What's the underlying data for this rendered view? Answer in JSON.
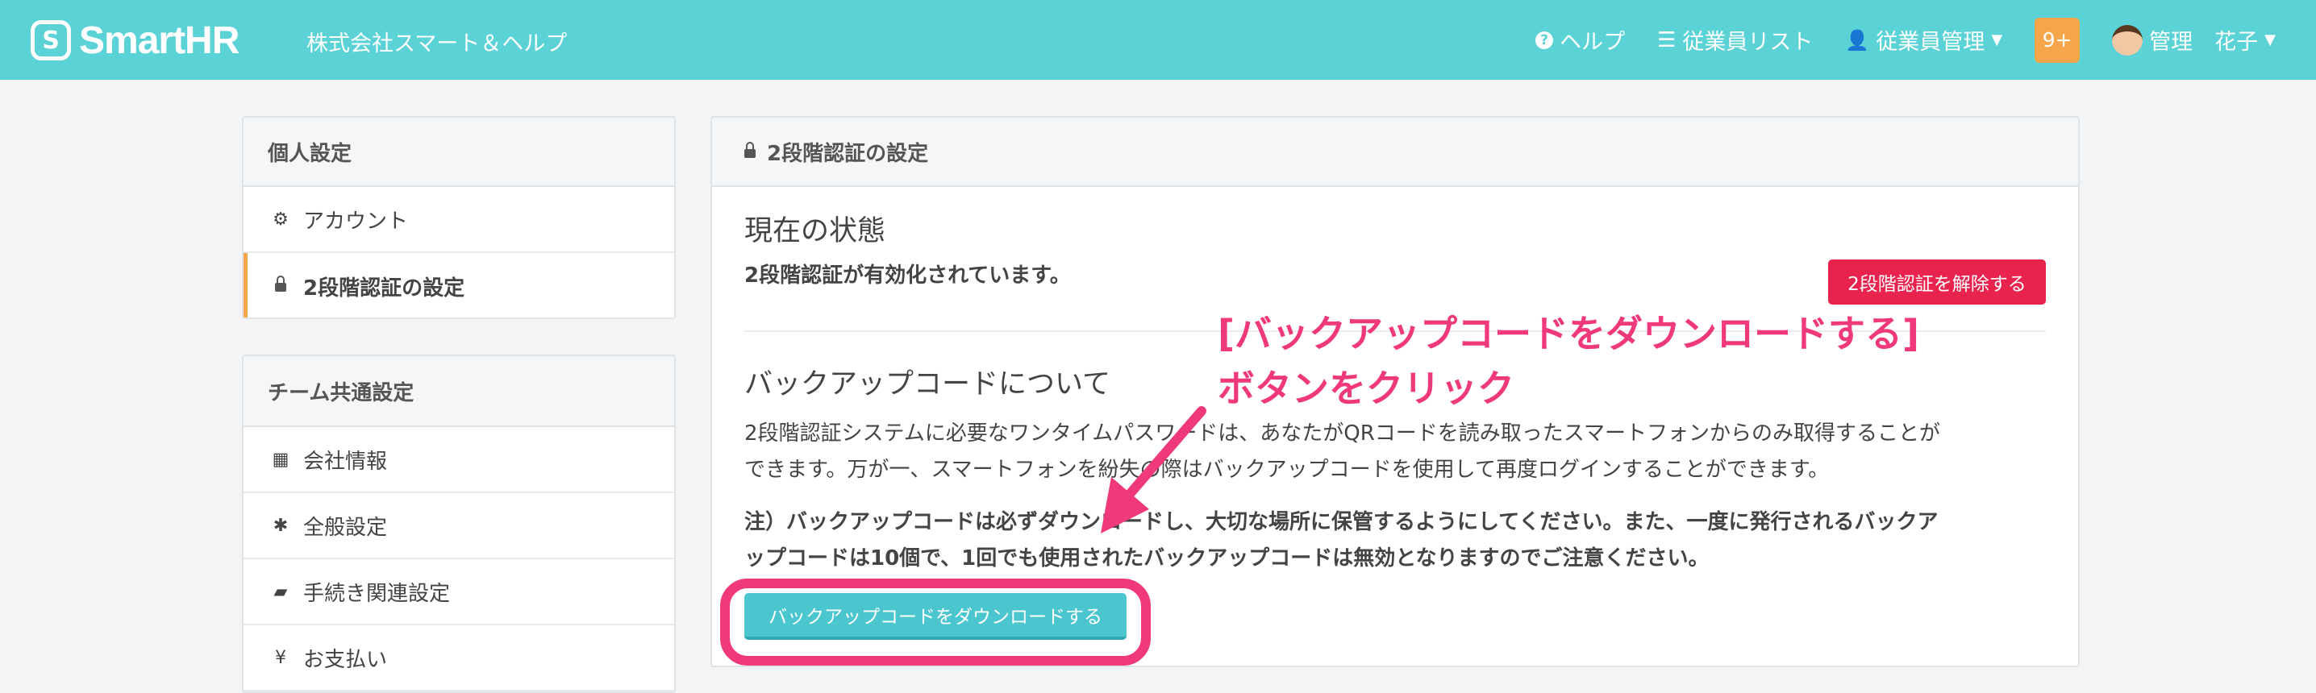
{
  "header": {
    "brand": "SmartHR",
    "logo_mark": "S",
    "company": "株式会社スマート＆ヘルプ",
    "help": "ヘルプ",
    "employee_list": "従業員リスト",
    "employee_manage": "従業員管理",
    "notification_badge": "9+",
    "user": "管理　花子",
    "icons": [
      "question-circle-icon",
      "list-icon",
      "user-icon",
      "chevron-down-icon"
    ],
    "colors": {
      "bar": "#5ad2d6",
      "badge": "#f5a64a"
    }
  },
  "sidebar": {
    "personal": {
      "title": "個人設定",
      "items": [
        {
          "label": "アカウント",
          "icon": "gear-icon"
        },
        {
          "label": "2段階認証の設定",
          "icon": "lock-icon",
          "active": true
        }
      ]
    },
    "team": {
      "title": "チーム共通設定",
      "items": [
        {
          "label": "会社情報",
          "icon": "building-icon"
        },
        {
          "label": "全般設定",
          "icon": "asterisk-icon"
        },
        {
          "label": "手続き関連設定",
          "icon": "book-icon"
        },
        {
          "label": "お支払い",
          "icon": "yen-icon"
        }
      ]
    }
  },
  "main": {
    "title": "2段階認証の設定",
    "status": {
      "heading": "現在の状態",
      "text": "2段階認証が有効化されています。",
      "disable_button": "2段階認証を解除する"
    },
    "backup": {
      "heading": "バックアップコードについて",
      "desc_line1": "2段階認証システムに必要なワンタイムパスワードは、あなたがQRコードを読み取ったスマートフォンからのみ取得することが",
      "desc_line2": "できます。万が一、スマートフォンを紛失の際はバックアップコードを使用して再度ログインすることができます。",
      "note_line1": "注）バックアップコードは必ずダウンロードし、大切な場所に保管するようにしてください。また、一度に発行されるバックア",
      "note_line2": "ップコードは10個で、1回でも使用されたバックアップコードは無効となりますのでご注意ください。",
      "download_button": "バックアップコードをダウンロードする"
    },
    "colors": {
      "danger": "#e8244e",
      "primary": "#4bc6cf"
    }
  },
  "annotation": {
    "line1": "[バックアップコードをダウンロードする]",
    "line2": "ボタンをクリック",
    "color": "#f0397a"
  }
}
